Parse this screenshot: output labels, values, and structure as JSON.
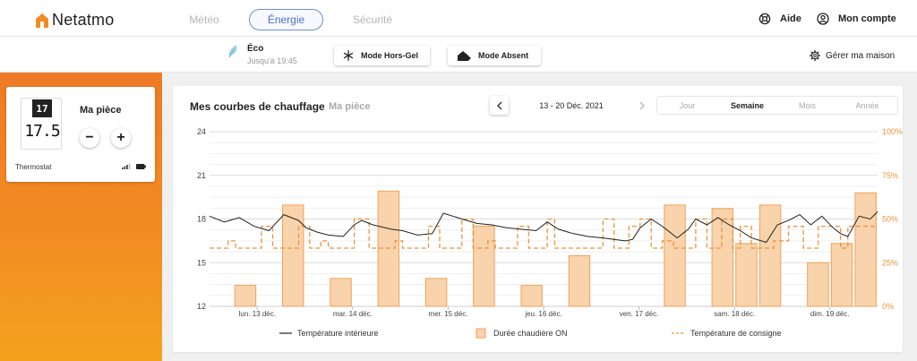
{
  "app": {
    "brand": "Netatmo",
    "tabs": [
      {
        "label": "Météo"
      },
      {
        "label": "Énergie"
      },
      {
        "label": "Sécurité"
      }
    ],
    "help_label": "Aide",
    "account_label": "Mon compte"
  },
  "mode_bar": {
    "mode_title": "Éco",
    "mode_until": "Jusqu'à 19:45",
    "frost_button": "Mode Hors-Gel",
    "away_button": "Mode Absent",
    "manage_home": "Gérer ma maison"
  },
  "room_card": {
    "thermostat_setpoint": "17",
    "current_temp": "17.5",
    "room_name": "Ma pièce",
    "minus_label": "−",
    "plus_label": "+",
    "device_label": "Thermostat"
  },
  "chart_panel": {
    "title": "Mes courbes de chauffage",
    "room": "Ma pièce",
    "date_range": "13 - 20 Déc. 2021",
    "periods": [
      "Jour",
      "Semaine",
      "Mois",
      "Année"
    ],
    "active_period": "Semaine"
  },
  "colors": {
    "accent": "#4a72c9",
    "orange": "#f28c22",
    "bar_fill": "#f9d3ac",
    "bar_stroke": "#f0a258",
    "axis_orange": "#e8943a"
  },
  "chart_data": {
    "type": "bar",
    "x_range": [
      0,
      7
    ],
    "categories": [
      "lun. 13 déc.",
      "mar. 14 déc.",
      "mer. 15 déc.",
      "jeu. 16 déc.",
      "ven. 17 déc.",
      "sam. 18 déc.",
      "dim. 19 déc."
    ],
    "category_positions": [
      0.5,
      1.5,
      2.5,
      3.5,
      4.5,
      5.5,
      6.5
    ],
    "y_left": {
      "ticks": [
        12,
        15,
        18,
        21,
        24
      ],
      "ylim": [
        12,
        24
      ]
    },
    "y_right": {
      "ticks": [
        "0%",
        "25%",
        "50%",
        "75%",
        "100%"
      ],
      "ylim": [
        0,
        100
      ]
    },
    "series": [
      {
        "name": "Durée chaudière ON",
        "axis": "right",
        "bars": [
          {
            "x": 0.375,
            "value": 12
          },
          {
            "x": 0.875,
            "value": 58
          },
          {
            "x": 1.375,
            "value": 16
          },
          {
            "x": 1.875,
            "value": 66
          },
          {
            "x": 2.375,
            "value": 16
          },
          {
            "x": 2.875,
            "value": 46
          },
          {
            "x": 3.375,
            "value": 12
          },
          {
            "x": 3.875,
            "value": 29
          },
          {
            "x": 4.875,
            "value": 58
          },
          {
            "x": 5.375,
            "value": 56
          },
          {
            "x": 5.625,
            "value": 36
          },
          {
            "x": 5.875,
            "value": 58
          },
          {
            "x": 6.375,
            "value": 25
          },
          {
            "x": 6.625,
            "value": 36
          },
          {
            "x": 6.875,
            "value": 65
          }
        ]
      },
      {
        "name": "Température intérieure",
        "axis": "left",
        "points": [
          [
            0,
            18.2
          ],
          [
            0.2,
            17.8
          ],
          [
            0.4,
            18.1
          ],
          [
            0.6,
            17.5
          ],
          [
            0.8,
            17.2
          ],
          [
            1.0,
            18.3
          ],
          [
            1.2,
            17.9
          ],
          [
            1.3,
            17.4
          ],
          [
            1.45,
            17.1
          ],
          [
            1.6,
            16.9
          ],
          [
            1.8,
            16.8
          ],
          [
            1.95,
            17.6
          ],
          [
            2.05,
            17.9
          ],
          [
            2.2,
            17.6
          ],
          [
            2.45,
            17.3
          ],
          [
            2.6,
            17.2
          ],
          [
            2.8,
            16.9
          ],
          [
            3.0,
            17.0
          ],
          [
            3.15,
            18.4
          ],
          [
            3.4,
            18.0
          ],
          [
            3.6,
            17.7
          ],
          [
            3.8,
            17.6
          ],
          [
            4.0,
            17.4
          ],
          [
            4.2,
            17.3
          ],
          [
            4.4,
            17.2
          ],
          [
            4.55,
            17.8
          ],
          [
            4.7,
            17.3
          ],
          [
            4.9,
            17.0
          ],
          [
            5.1,
            16.8
          ],
          [
            5.3,
            16.7
          ],
          [
            5.45,
            16.6
          ],
          [
            5.6,
            16.5
          ],
          [
            5.7,
            16.6
          ],
          [
            5.8,
            17.4
          ],
          [
            5.95,
            18.0
          ],
          [
            6.1,
            17.5
          ],
          [
            6.3,
            16.7
          ],
          [
            6.45,
            17.3
          ],
          [
            6.55,
            18.0
          ],
          [
            6.7,
            17.6
          ],
          [
            6.85,
            18.1
          ],
          [
            7.0,
            17.6
          ],
          [
            7.15,
            17.2
          ],
          [
            7.3,
            16.7
          ],
          [
            7.5,
            16.4
          ],
          [
            7.65,
            17.6
          ],
          [
            7.8,
            17.9
          ],
          [
            7.95,
            18.3
          ],
          [
            8.1,
            17.6
          ],
          [
            8.25,
            18.2
          ],
          [
            8.4,
            17.4
          ],
          [
            8.5,
            17.0
          ],
          [
            8.6,
            16.8
          ],
          [
            8.75,
            18.2
          ],
          [
            8.9,
            18.0
          ],
          [
            9.0,
            18.5
          ]
        ]
      },
      {
        "name": "Température de consigne",
        "axis": "left",
        "dashed": true,
        "points": [
          [
            0,
            16.0
          ],
          [
            0.25,
            16.0
          ],
          [
            0.25,
            16.5
          ],
          [
            0.35,
            16.5
          ],
          [
            0.35,
            16.0
          ],
          [
            0.7,
            16.0
          ],
          [
            0.7,
            17.5
          ],
          [
            0.85,
            17.5
          ],
          [
            0.85,
            16.0
          ],
          [
            1.2,
            16.0
          ],
          [
            1.2,
            17.5
          ],
          [
            1.35,
            17.5
          ],
          [
            1.35,
            16.0
          ],
          [
            1.5,
            16.0
          ],
          [
            1.5,
            16.5
          ],
          [
            1.6,
            16.5
          ],
          [
            1.6,
            16.0
          ],
          [
            1.95,
            16.0
          ],
          [
            1.95,
            18.0
          ],
          [
            2.15,
            18.0
          ],
          [
            2.15,
            16.0
          ],
          [
            2.5,
            16.0
          ],
          [
            2.5,
            16.5
          ],
          [
            2.6,
            16.5
          ],
          [
            2.6,
            16.0
          ],
          [
            2.95,
            16.0
          ],
          [
            2.95,
            17.5
          ],
          [
            3.1,
            17.5
          ],
          [
            3.1,
            16.0
          ],
          [
            3.4,
            16.0
          ],
          [
            3.4,
            18.0
          ],
          [
            3.55,
            18.0
          ],
          [
            3.55,
            16.0
          ],
          [
            3.75,
            16.0
          ],
          [
            3.75,
            16.5
          ],
          [
            3.85,
            16.5
          ],
          [
            3.85,
            16.0
          ],
          [
            4.15,
            16.0
          ],
          [
            4.15,
            17.5
          ],
          [
            4.3,
            17.5
          ],
          [
            4.3,
            16.0
          ],
          [
            4.55,
            16.0
          ],
          [
            4.55,
            18.0
          ],
          [
            4.65,
            18.0
          ],
          [
            4.65,
            16.0
          ],
          [
            5.3,
            16.0
          ],
          [
            5.3,
            18.0
          ],
          [
            5.45,
            18.0
          ],
          [
            5.45,
            16.0
          ],
          [
            5.65,
            16.0
          ],
          [
            5.65,
            17.5
          ],
          [
            5.8,
            17.5
          ],
          [
            5.8,
            18.0
          ],
          [
            5.95,
            18.0
          ],
          [
            5.95,
            16.0
          ],
          [
            6.1,
            16.0
          ],
          [
            6.1,
            16.5
          ],
          [
            6.25,
            16.5
          ],
          [
            6.25,
            16.0
          ],
          [
            6.55,
            16.0
          ],
          [
            6.55,
            18.0
          ],
          [
            6.7,
            18.0
          ],
          [
            6.7,
            16.0
          ],
          [
            6.9,
            16.0
          ],
          [
            6.9,
            18.0
          ],
          [
            7.05,
            18.0
          ],
          [
            7.05,
            16.0
          ],
          [
            7.15,
            16.0
          ],
          [
            7.15,
            17.5
          ],
          [
            7.3,
            17.5
          ],
          [
            7.3,
            16.0
          ],
          [
            7.6,
            16.0
          ],
          [
            7.6,
            16.5
          ],
          [
            7.8,
            16.5
          ],
          [
            7.8,
            17.5
          ],
          [
            8.0,
            17.5
          ],
          [
            8.0,
            16.0
          ],
          [
            8.2,
            16.0
          ],
          [
            8.2,
            17.5
          ],
          [
            8.5,
            17.5
          ],
          [
            8.5,
            16.0
          ],
          [
            8.6,
            16.0
          ],
          [
            8.6,
            17.5
          ],
          [
            9.0,
            17.5
          ]
        ]
      }
    ],
    "legend": {
      "position": "bottom",
      "entries": [
        "Température intérieure",
        "Durée chaudière ON",
        "Température de consigne"
      ]
    },
    "grid": true
  }
}
